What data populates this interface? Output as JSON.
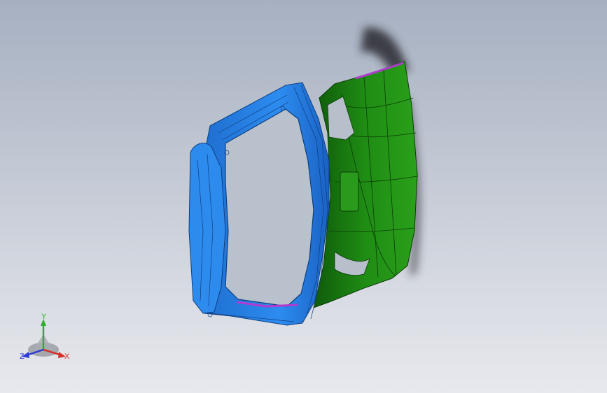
{
  "viewport": {
    "colors": {
      "bg_top": "#a6b0c1",
      "bg_bottom": "#e8e9ee",
      "inner_panel": "#1c8a12",
      "outer_frame": "#2b86e6",
      "seal_edge": "#b23ad0"
    }
  },
  "model": {
    "parts": [
      "tailgate-inner-frame",
      "tailgate-outer-panel",
      "hinge-bracket-shadow"
    ]
  },
  "triad": {
    "y_label": "Y",
    "x_label": "X",
    "z_label": "Z",
    "y_color": "#2fae2f",
    "x_color": "#d6322c",
    "z_color": "#2e3ad6"
  }
}
